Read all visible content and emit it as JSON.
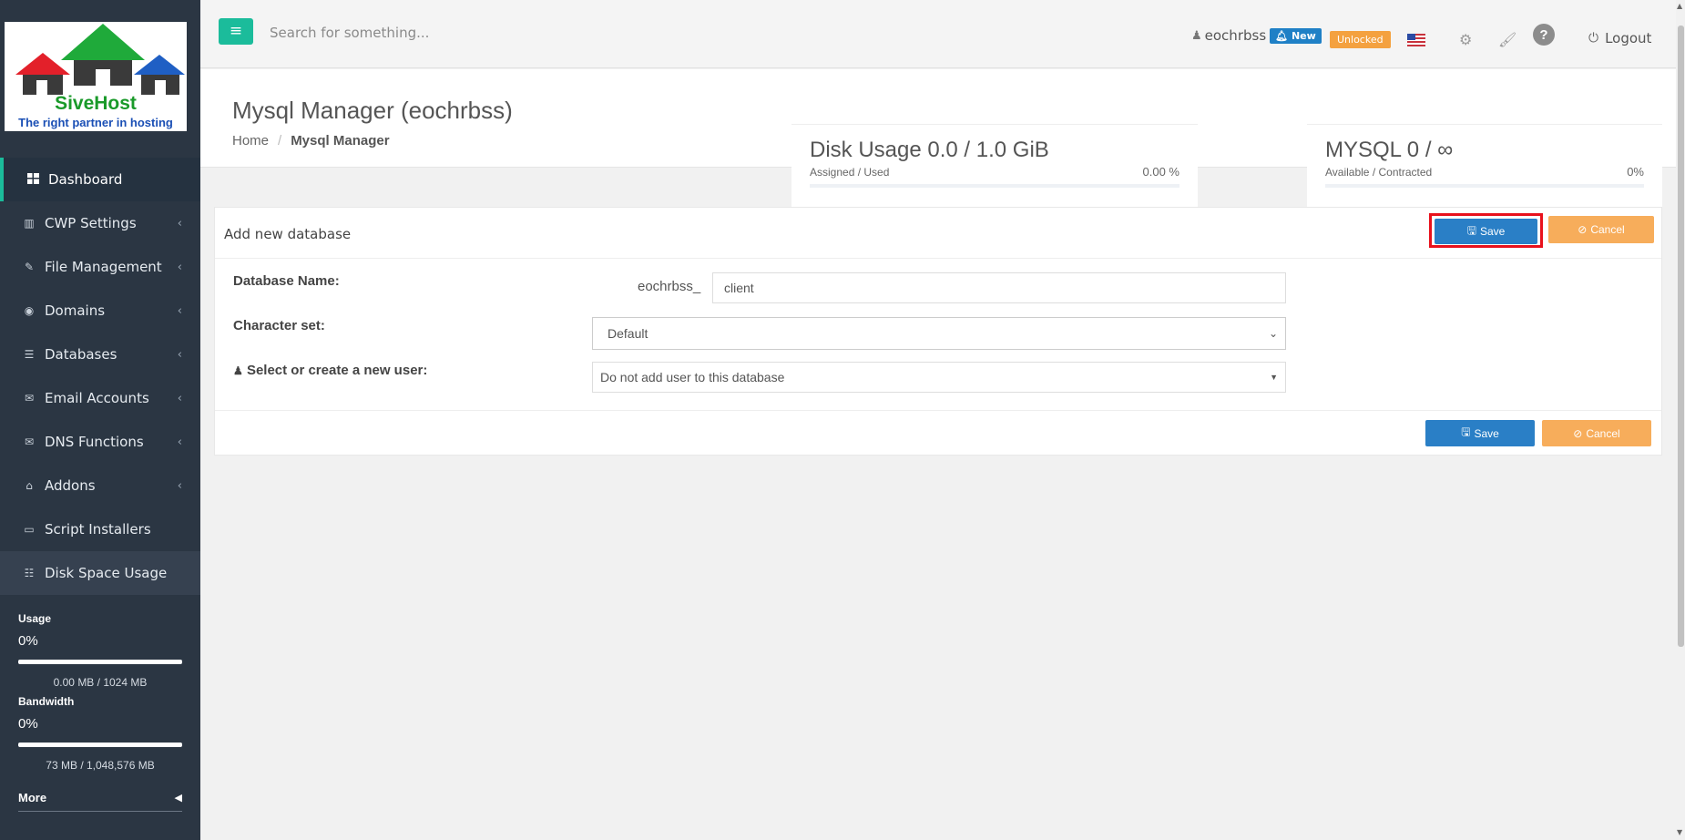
{
  "brand": {
    "name": "SiveHost",
    "tagline": "The right partner in hosting"
  },
  "header": {
    "search_placeholder": "Search for something...",
    "username": "eochrbss",
    "new_badge": "New",
    "status_badge": "Unlocked",
    "logout_label": "Logout"
  },
  "sidebar": {
    "items": [
      {
        "label": "Dashboard",
        "icon": "grid-icon"
      },
      {
        "label": "CWP Settings",
        "icon": "chart-icon"
      },
      {
        "label": "File Management",
        "icon": "edit-icon"
      },
      {
        "label": "Domains",
        "icon": "globe-icon"
      },
      {
        "label": "Databases",
        "icon": "database-icon"
      },
      {
        "label": "Email Accounts",
        "icon": "envelope-icon"
      },
      {
        "label": "DNS Functions",
        "icon": "envelope-icon"
      },
      {
        "label": "Addons",
        "icon": "bank-icon"
      },
      {
        "label": "Script Installers",
        "icon": "monitor-icon"
      },
      {
        "label": "Disk Space Usage",
        "icon": "drive-icon"
      }
    ],
    "usage": {
      "label": "Usage",
      "percent": "0%",
      "fill_fraction": 0,
      "detail": "0.00 MB / 1024 MB"
    },
    "bandwidth": {
      "label": "Bandwidth",
      "percent": "0%",
      "fill_fraction": 0,
      "detail": "73 MB / 1,048,576 MB"
    },
    "more_label": "More"
  },
  "page": {
    "title": "Mysql Manager (eochrbss)",
    "breadcrumb_home": "Home",
    "breadcrumb_sep": "/",
    "breadcrumb_current": "Mysql Manager"
  },
  "stats": {
    "disk": {
      "title": "Disk Usage 0.0 / 1.0 GiB",
      "sub": "Assigned / Used",
      "pct": "0.00 %",
      "fill_fraction": 0
    },
    "mysql": {
      "title": "MYSQL 0 / ∞",
      "sub": "Available / Contracted",
      "pct": "0%",
      "fill_fraction": 0
    }
  },
  "form": {
    "panel_title": "Add new database",
    "save_label": "Save",
    "cancel_label": "Cancel",
    "db_name_label": "Database Name:",
    "db_prefix": "eochrbss_",
    "db_name_value": "client",
    "charset_label": "Character set:",
    "charset_value": "Default",
    "user_label": "Select or create a new user:",
    "user_value": "Do not add user to this database"
  },
  "colors": {
    "sidebar_bg": "#2b3643",
    "accent": "#1bbc9b",
    "primary": "#2a7fc6",
    "warning": "#f7ad5b",
    "highlight": "#e8111c"
  }
}
